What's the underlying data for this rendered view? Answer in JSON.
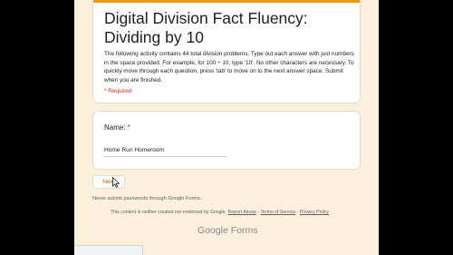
{
  "form": {
    "title": "Digital Division Fact Fluency: Dividing by 10",
    "description": "The following activity contains 44 total division problems. Type out each answer with just numbers in the space provided. For example, for 100 ÷ 10, type '10'. No other characters are necessary. To quickly move through each question, press 'tab' to move on to the next answer space. Submit when you are finished.",
    "required_note": "* Required",
    "accent_color": "#f29a0f"
  },
  "question": {
    "label": "Name:",
    "required_marker": "*",
    "value": "Home Run Homeroom"
  },
  "footer": {
    "next_label": "Next",
    "password_warning": "Never submit passwords through Google Forms.",
    "disclaimer_text": "This content is neither created nor endorsed by Google.",
    "report_abuse": "Report Abuse",
    "sep1": " - ",
    "terms": "Terms of Service",
    "sep2": " - ",
    "privacy": "Privacy Policy",
    "brand": "Google Forms"
  }
}
